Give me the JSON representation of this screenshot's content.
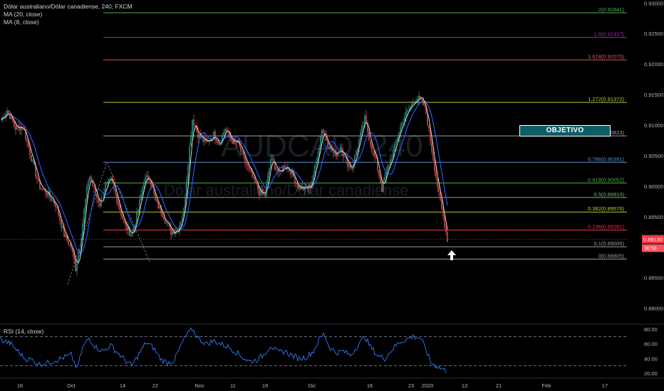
{
  "legend": {
    "symbol": "Dólar australiano/Dólar canadiense, 240, FXCM",
    "ma1": "MA (20, close)",
    "ma2": "MA (8, close)"
  },
  "watermark": {
    "ticker": "AUDCAD, 240",
    "name": "Dólar australiano/Dólar canadiense"
  },
  "rsi_label": "RSI (14, close)",
  "target_label": "OBJETIVO",
  "last_price": "0.89130",
  "countdown": "30:50",
  "colors": {
    "up": "#26a69a",
    "down": "#ef5350",
    "ma20": "#2962ff",
    "ma8": "#e6e6e6",
    "rsi": "#3179f5",
    "price_line": "#f23645",
    "target_fill": "#0c5e66"
  },
  "chart_data": {
    "type": "candlestick",
    "price_axis": {
      "ticks": [
        "0.93000",
        "0.92500",
        "0.92000",
        "0.91500",
        "0.91000",
        "0.90500",
        "0.90000",
        "0.89500",
        "0.89000",
        "0.88500",
        "0.88000"
      ]
    },
    "time_axis": {
      "ticks": [
        "16",
        "Oct",
        "14",
        "22",
        "Nov",
        "11",
        "19",
        "Dic",
        "16",
        "23",
        "2020",
        "13",
        "21",
        "Feb",
        "17"
      ]
    },
    "fib_levels": [
      {
        "ratio": "0",
        "price": "0.88805",
        "label": "0(0.88805)",
        "color": "#9e9e9e"
      },
      {
        "ratio": "0.1",
        "price": "0.89006",
        "label": "0.1(0.89006)",
        "color": "#9e9e9e"
      },
      {
        "ratio": "0.236",
        "price": "0.89281",
        "label": "0.236(0.89281)",
        "color": "#f23645"
      },
      {
        "ratio": "0.382",
        "price": "0.89576",
        "label": "0.382(0.89576)",
        "color": "#c0ca33"
      },
      {
        "ratio": "0.5",
        "price": "0.89814",
        "label": "0.5(0.89814)",
        "color": "#66bb6a"
      },
      {
        "ratio": "0.618",
        "price": "0.90052",
        "label": "0.618(0.90052)",
        "color": "#4caf50"
      },
      {
        "ratio": "0.786",
        "price": "0.90391",
        "label": "0.786(0.90391)",
        "color": "#5d8fcf"
      },
      {
        "ratio": "1",
        "price": "0.90823",
        "label": "1(0.90823)",
        "color": "#9e9e9e"
      },
      {
        "ratio": "1.272",
        "price": "0.91372",
        "label": "1.272(0.91372)",
        "color": "#c0ca33"
      },
      {
        "ratio": "1.618",
        "price": "0.92070",
        "label": "1.618(0.92070)",
        "color": "#ef5350"
      },
      {
        "ratio": "1.8",
        "price": "0.92437",
        "label": "1.8(0.92437)",
        "color": "#9c27b0"
      },
      {
        "ratio": "2",
        "price": "0.92841",
        "label": "2(0.92841)",
        "color": "#4caf50"
      }
    ],
    "price_path": [
      [
        0,
        0.9105
      ],
      [
        10,
        0.9125
      ],
      [
        22,
        0.9095
      ],
      [
        32,
        0.9098
      ],
      [
        42,
        0.9055
      ],
      [
        55,
        0.9
      ],
      [
        65,
        0.899
      ],
      [
        78,
        0.897
      ],
      [
        90,
        0.892
      ],
      [
        100,
        0.89
      ],
      [
        106,
        0.8865
      ],
      [
        112,
        0.89
      ],
      [
        118,
        0.896
      ],
      [
        125,
        0.902
      ],
      [
        133,
        0.899
      ],
      [
        140,
        0.897
      ],
      [
        148,
        0.9
      ],
      [
        156,
        0.901
      ],
      [
        165,
        0.8975
      ],
      [
        175,
        0.8935
      ],
      [
        185,
        0.892
      ],
      [
        193,
        0.8955
      ],
      [
        202,
        0.901
      ],
      [
        210,
        0.9015
      ],
      [
        218,
        0.8975
      ],
      [
        228,
        0.8955
      ],
      [
        240,
        0.8925
      ],
      [
        250,
        0.893
      ],
      [
        258,
        0.896
      ],
      [
        264,
        0.904
      ],
      [
        270,
        0.911
      ],
      [
        278,
        0.9085
      ],
      [
        290,
        0.907
      ],
      [
        300,
        0.9085
      ],
      [
        308,
        0.907
      ],
      [
        316,
        0.9095
      ],
      [
        324,
        0.9075
      ],
      [
        334,
        0.907
      ],
      [
        344,
        0.904
      ],
      [
        354,
        0.9015
      ],
      [
        364,
        0.899
      ],
      [
        372,
        0.8985
      ],
      [
        380,
        0.9045
      ],
      [
        392,
        0.902
      ],
      [
        400,
        0.9035
      ],
      [
        408,
        0.9025
      ],
      [
        418,
        0.9
      ],
      [
        428,
        0.8995
      ],
      [
        436,
        0.9
      ],
      [
        444,
        0.904
      ],
      [
        452,
        0.9095
      ],
      [
        460,
        0.907
      ],
      [
        470,
        0.905
      ],
      [
        478,
        0.9065
      ],
      [
        486,
        0.904
      ],
      [
        494,
        0.903
      ],
      [
        504,
        0.9075
      ],
      [
        512,
        0.911
      ],
      [
        520,
        0.907
      ],
      [
        528,
        0.904
      ],
      [
        536,
        0.8995
      ],
      [
        544,
        0.903
      ],
      [
        552,
        0.9055
      ],
      [
        560,
        0.909
      ],
      [
        568,
        0.9115
      ],
      [
        576,
        0.913
      ],
      [
        584,
        0.9145
      ],
      [
        592,
        0.914
      ],
      [
        598,
        0.912
      ],
      [
        604,
        0.9075
      ],
      [
        610,
        0.903
      ],
      [
        616,
        0.8985
      ],
      [
        622,
        0.895
      ],
      [
        628,
        0.8913
      ]
    ],
    "rsi": {
      "ticks": [
        "80.00",
        "60.00",
        "40.00",
        "20.00"
      ],
      "levels": [
        70,
        30
      ],
      "path": [
        [
          0,
          66
        ],
        [
          15,
          60
        ],
        [
          25,
          50
        ],
        [
          35,
          40
        ],
        [
          45,
          38
        ],
        [
          55,
          32
        ],
        [
          70,
          35
        ],
        [
          85,
          40
        ],
        [
          100,
          45
        ],
        [
          108,
          25
        ],
        [
          116,
          55
        ],
        [
          125,
          68
        ],
        [
          135,
          55
        ],
        [
          145,
          50
        ],
        [
          155,
          58
        ],
        [
          165,
          48
        ],
        [
          175,
          38
        ],
        [
          185,
          30
        ],
        [
          195,
          46
        ],
        [
          205,
          62
        ],
        [
          215,
          55
        ],
        [
          225,
          40
        ],
        [
          235,
          34
        ],
        [
          245,
          38
        ],
        [
          255,
          60
        ],
        [
          262,
          72
        ],
        [
          270,
          80
        ],
        [
          280,
          66
        ],
        [
          290,
          60
        ],
        [
          300,
          64
        ],
        [
          310,
          60
        ],
        [
          320,
          56
        ],
        [
          330,
          50
        ],
        [
          340,
          42
        ],
        [
          350,
          36
        ],
        [
          360,
          38
        ],
        [
          370,
          45
        ],
        [
          380,
          58
        ],
        [
          390,
          48
        ],
        [
          400,
          50
        ],
        [
          410,
          44
        ],
        [
          420,
          40
        ],
        [
          430,
          42
        ],
        [
          440,
          50
        ],
        [
          448,
          66
        ],
        [
          455,
          74
        ],
        [
          462,
          56
        ],
        [
          472,
          48
        ],
        [
          482,
          50
        ],
        [
          492,
          44
        ],
        [
          502,
          58
        ],
        [
          512,
          70
        ],
        [
          520,
          56
        ],
        [
          530,
          44
        ],
        [
          540,
          40
        ],
        [
          550,
          52
        ],
        [
          560,
          62
        ],
        [
          570,
          66
        ],
        [
          580,
          70
        ],
        [
          590,
          68
        ],
        [
          598,
          52
        ],
        [
          605,
          34
        ],
        [
          612,
          30
        ],
        [
          620,
          26
        ],
        [
          628,
          22
        ]
      ]
    }
  }
}
